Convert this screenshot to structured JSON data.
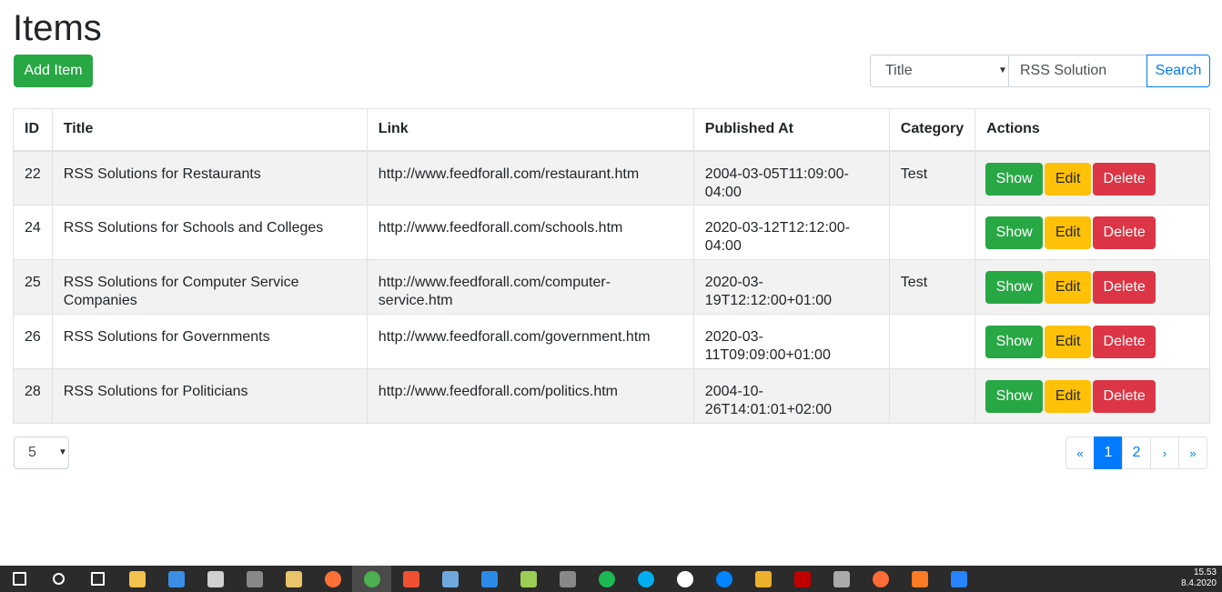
{
  "page": {
    "title": "Items"
  },
  "toolbar": {
    "add_label": "Add Item"
  },
  "search": {
    "field": "Title",
    "query": "RSS Solution",
    "button_label": "Search"
  },
  "table": {
    "headers": {
      "id": "ID",
      "title": "Title",
      "link": "Link",
      "published": "Published At",
      "category": "Category",
      "actions": "Actions"
    },
    "action_labels": {
      "show": "Show",
      "edit": "Edit",
      "delete": "Delete"
    },
    "rows": [
      {
        "id": "22",
        "title": "RSS Solutions for Restaurants",
        "link": "http://www.feedforall.com/restaurant.htm",
        "published": "2004-03-05T11:09:00-04:00",
        "category": "Test"
      },
      {
        "id": "24",
        "title": "RSS Solutions for Schools and Colleges",
        "link": "http://www.feedforall.com/schools.htm",
        "published": "2020-03-12T12:12:00-04:00",
        "category": ""
      },
      {
        "id": "25",
        "title": "RSS Solutions for Computer Service Companies",
        "link": "http://www.feedforall.com/computer-service.htm",
        "published": "2020-03-19T12:12:00+01:00",
        "category": "Test"
      },
      {
        "id": "26",
        "title": "RSS Solutions for Governments",
        "link": "http://www.feedforall.com/government.htm",
        "published": "2020-03-11T09:09:00+01:00",
        "category": ""
      },
      {
        "id": "28",
        "title": "RSS Solutions for Politicians",
        "link": "http://www.feedforall.com/politics.htm",
        "published": "2004-10-26T14:01:01+02:00",
        "category": ""
      }
    ]
  },
  "per_page": "5",
  "pagination": {
    "first": "«",
    "pages": [
      "1",
      "2"
    ],
    "current": "1",
    "next": "›",
    "last": "»"
  },
  "taskbar": {
    "icons": [
      "windows-start-icon",
      "search-icon",
      "task-view-icon",
      "file-explorer-icon",
      "mail-icon",
      "calculator-icon",
      "app-icon",
      "paint-icon",
      "firefox-icon",
      "chrome-icon",
      "git-icon",
      "virtualbox-icon",
      "vscode-icon",
      "notepad-icon",
      "app-icon",
      "spotify-icon",
      "skype-icon",
      "wechat-icon",
      "messenger-icon",
      "slack-icon",
      "filezilla-icon",
      "database-icon",
      "postman-icon",
      "xampp-icon",
      "sourcetree-icon"
    ],
    "time": "15.53",
    "date": "8.4.2020"
  },
  "colors": {
    "success": "#28a745",
    "warning": "#ffc107",
    "danger": "#dc3545",
    "primary": "#007bff",
    "taskbar": "#2b2b2b"
  }
}
